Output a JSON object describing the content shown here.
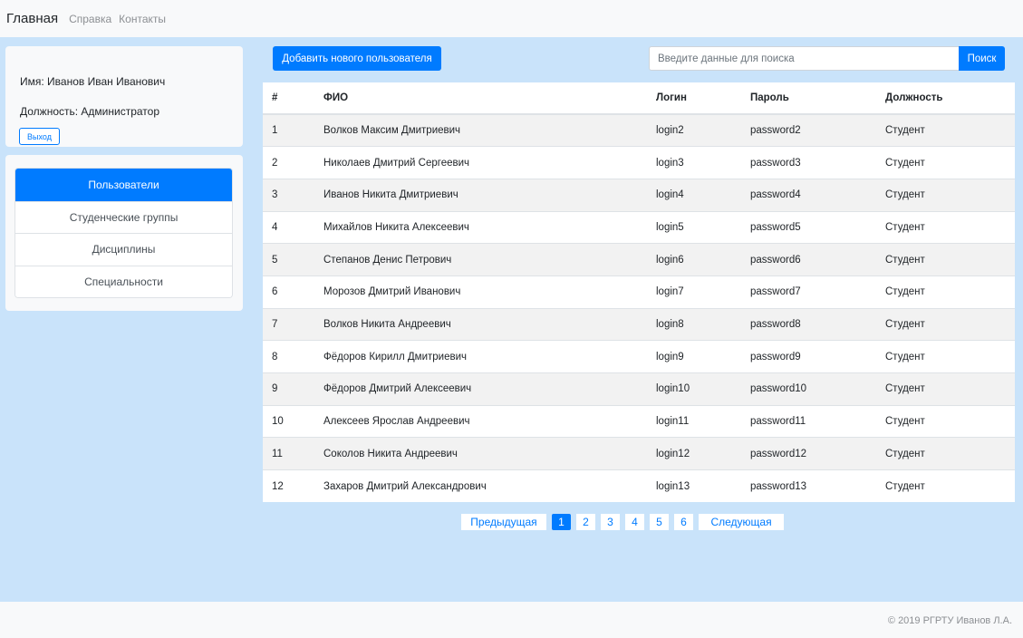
{
  "nav": {
    "brand": "Главная",
    "links": [
      "Справка",
      "Контакты"
    ]
  },
  "user": {
    "name": "Имя: Иванов Иван Иванович",
    "role": "Должность: Администратор",
    "logout_label": "Выход"
  },
  "menu": {
    "items": [
      {
        "label": "Пользователи",
        "active": true
      },
      {
        "label": "Студенческие группы",
        "active": false
      },
      {
        "label": "Дисциплины",
        "active": false
      },
      {
        "label": "Специальности",
        "active": false
      }
    ]
  },
  "toolbar": {
    "add_label": "Добавить нового пользователя",
    "search_placeholder": "Введите данные для поиска",
    "search_label": "Поиск"
  },
  "table": {
    "columns": [
      "#",
      "ФИО",
      "Логин",
      "Пароль",
      "Должность"
    ],
    "rows": [
      [
        "1",
        "Волков Максим Дмитриевич",
        "login2",
        "password2",
        "Студент"
      ],
      [
        "2",
        "Николаев Дмитрий Сергеевич",
        "login3",
        "password3",
        "Студент"
      ],
      [
        "3",
        "Иванов Никита Дмитриевич",
        "login4",
        "password4",
        "Студент"
      ],
      [
        "4",
        "Михайлов Никита Алексеевич",
        "login5",
        "password5",
        "Студент"
      ],
      [
        "5",
        "Степанов Денис Петрович",
        "login6",
        "password6",
        "Студент"
      ],
      [
        "6",
        "Морозов Дмитрий Иванович",
        "login7",
        "password7",
        "Студент"
      ],
      [
        "7",
        "Волков Никита Андреевич",
        "login8",
        "password8",
        "Студент"
      ],
      [
        "8",
        "Фёдоров Кирилл Дмитриевич",
        "login9",
        "password9",
        "Студент"
      ],
      [
        "9",
        "Фёдоров Дмитрий Алексеевич",
        "login10",
        "password10",
        "Студент"
      ],
      [
        "10",
        "Алексеев Ярослав Андреевич",
        "login11",
        "password11",
        "Студент"
      ],
      [
        "11",
        "Соколов Никита Андреевич",
        "login12",
        "password12",
        "Студент"
      ],
      [
        "12",
        "Захаров Дмитрий Александрович",
        "login13",
        "password13",
        "Студент"
      ]
    ]
  },
  "pagination": {
    "prev_label": "Предыдущая",
    "pages": [
      "1",
      "2",
      "3",
      "4",
      "5",
      "6"
    ],
    "current_page": "1",
    "next_label": "Следующая"
  },
  "footer": {
    "text": "© 2019 РГРТУ Иванов Л.А."
  }
}
